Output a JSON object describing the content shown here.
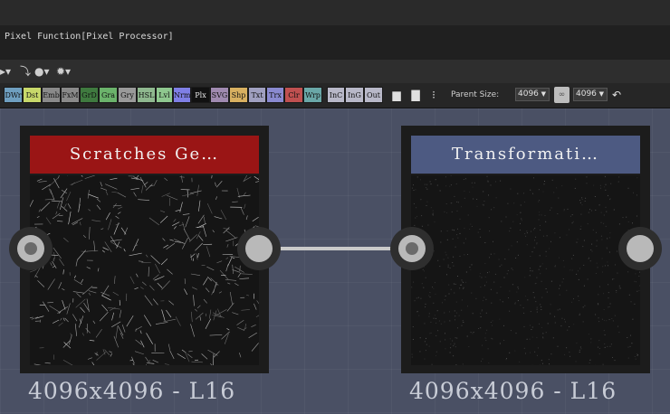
{
  "window": {
    "title": "Pixel Function[Pixel Processor]"
  },
  "toolbar": {
    "icons": [
      {
        "name": "arrow-tool-icon",
        "glyph": "▸▾"
      },
      {
        "name": "connector-icon",
        "glyph": "⤵"
      },
      {
        "name": "bomb-icon",
        "glyph": "●▾"
      },
      {
        "name": "gear-icon",
        "glyph": "✹▾"
      }
    ]
  },
  "filters": {
    "buttons": [
      {
        "label": "DWr",
        "color": "#6f9fc0"
      },
      {
        "label": "Dst",
        "color": "#c8d86a"
      },
      {
        "label": "Emb",
        "color": "#8a8a8a"
      },
      {
        "label": "FxM",
        "color": "#8a8a8a"
      },
      {
        "label": "GrD",
        "color": "#3f7a3f"
      },
      {
        "label": "Gra",
        "color": "#6bb36b"
      },
      {
        "label": "Gry",
        "color": "#9a9a9a"
      },
      {
        "label": "HSL",
        "color": "#8fb88f"
      },
      {
        "label": "Lvl",
        "color": "#8fc88f"
      },
      {
        "label": "Nrm",
        "color": "#7f7fe6"
      },
      {
        "label": "Plx",
        "color": "#111111"
      },
      {
        "label": "SVG",
        "color": "#a08ab0"
      },
      {
        "label": "Shp",
        "color": "#d8b060"
      },
      {
        "label": "Txt",
        "color": "#a0a0c0"
      },
      {
        "label": "Trx",
        "color": "#8a8ad0"
      },
      {
        "label": "Clr",
        "color": "#c05050"
      },
      {
        "label": "Wrp",
        "color": "#6aa8a8"
      },
      {
        "label": "InC",
        "color": "#b8b8c8"
      },
      {
        "label": "InG",
        "color": "#b8b8c8"
      },
      {
        "label": "Out",
        "color": "#b8b8c8"
      }
    ],
    "extra_icons": [
      {
        "name": "comment-icon",
        "glyph": "▆"
      },
      {
        "name": "frame-icon",
        "glyph": "▇"
      },
      {
        "name": "pin-icon",
        "glyph": "⁝"
      }
    ],
    "parent_size_label": "Parent Size:",
    "parent_size_value": "4096",
    "link_icon": "∞",
    "size_value": "4096",
    "reset_icon": "↶"
  },
  "graph": {
    "nodes": [
      {
        "title": "Scratches Ge…",
        "color": "#9a1515",
        "size_label": "4096x4096 - L16"
      },
      {
        "title": "Transformati…",
        "color": "#4d5a82",
        "size_label": "4096x4096 - L16"
      }
    ]
  }
}
